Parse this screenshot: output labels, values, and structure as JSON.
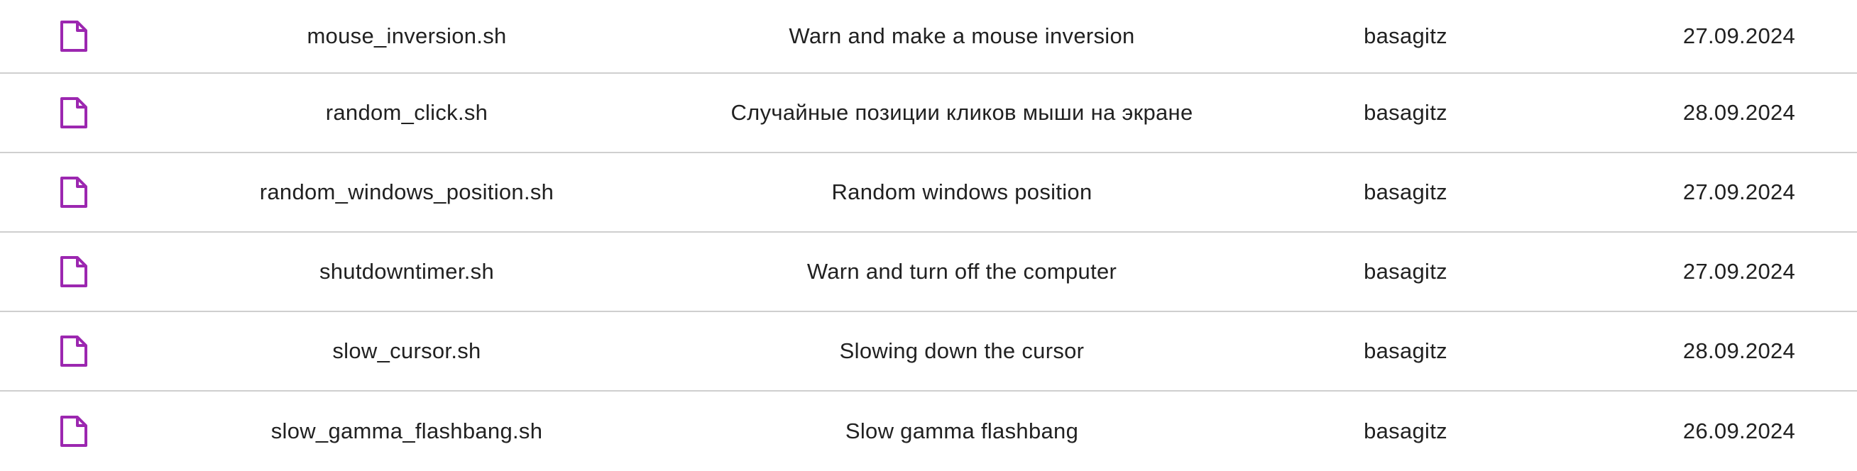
{
  "colors": {
    "icon": "#9c27b0",
    "divider": "#cfcfcf",
    "text": "#212121"
  },
  "files": [
    {
      "icon": "file-icon",
      "name": "mouse_inversion.sh",
      "description": "Warn and make a mouse inversion",
      "author": "basagitz",
      "date": "27.09.2024"
    },
    {
      "icon": "file-icon",
      "name": "random_click.sh",
      "description": "Случайные позиции кликов мыши на экране",
      "author": "basagitz",
      "date": "28.09.2024"
    },
    {
      "icon": "file-icon",
      "name": "random_windows_position.sh",
      "description": "Random windows position",
      "author": "basagitz",
      "date": "27.09.2024"
    },
    {
      "icon": "file-icon",
      "name": "shutdowntimer.sh",
      "description": "Warn and turn off the computer",
      "author": "basagitz",
      "date": "27.09.2024"
    },
    {
      "icon": "file-icon",
      "name": "slow_cursor.sh",
      "description": "Slowing down the cursor",
      "author": "basagitz",
      "date": "28.09.2024"
    },
    {
      "icon": "file-icon",
      "name": "slow_gamma_flashbang.sh",
      "description": "Slow gamma flashbang",
      "author": "basagitz",
      "date": "26.09.2024"
    }
  ]
}
